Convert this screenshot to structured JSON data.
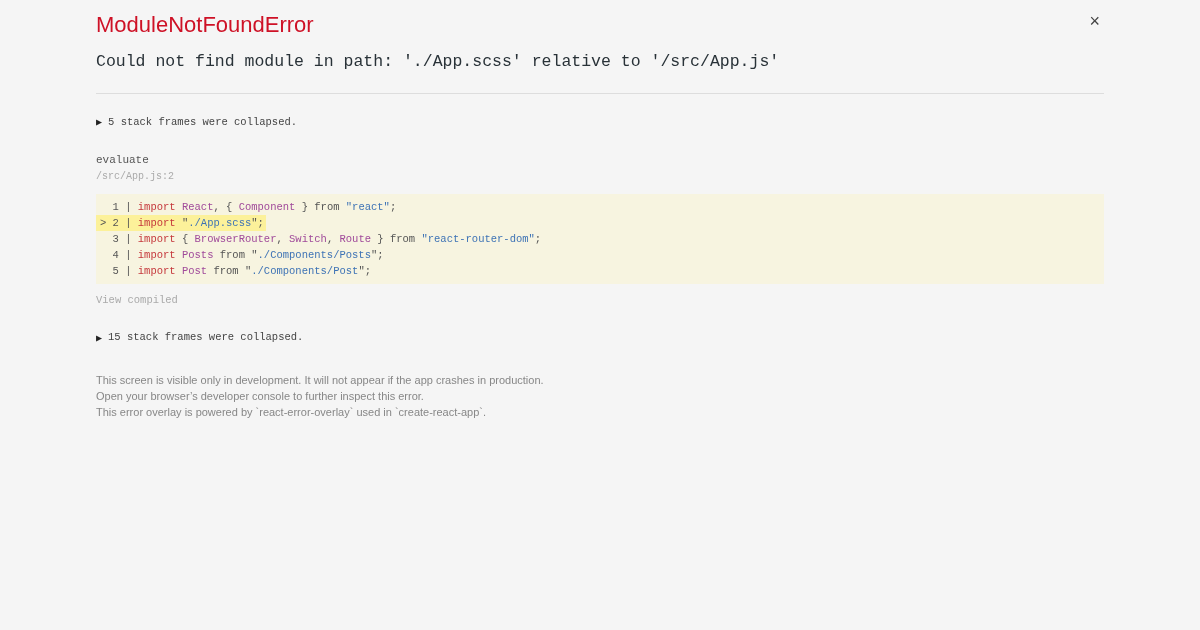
{
  "header": {
    "title": "ModuleNotFoundError",
    "close": "×",
    "message": "Could not find module in path: './App.scss' relative to '/src/App.js'"
  },
  "frames_top": {
    "toggle": "▶",
    "text": "5 stack frames were collapsed."
  },
  "frame": {
    "function": "evaluate",
    "location": "/src/App.js:2",
    "code_lines": [
      {
        "gutter": "  1 | ",
        "selected": false,
        "tokens": [
          {
            "kind": "keyword",
            "text": "import "
          },
          {
            "kind": "ident",
            "text": "React"
          },
          {
            "kind": "plain",
            "text": ", { "
          },
          {
            "kind": "ident",
            "text": "Component"
          },
          {
            "kind": "plain",
            "text": " } from "
          },
          {
            "kind": "string",
            "text": "\"react\""
          },
          {
            "kind": "plain",
            "text": ";"
          }
        ]
      },
      {
        "gutter": "> 2 | ",
        "selected": true,
        "tokens": [
          {
            "kind": "keyword",
            "text": "import"
          },
          {
            "kind": "plain",
            "text": " \""
          },
          {
            "kind": "string",
            "text": "./App.scss"
          },
          {
            "kind": "plain",
            "text": "\";"
          }
        ]
      },
      {
        "gutter": "  3 | ",
        "selected": false,
        "tokens": [
          {
            "kind": "keyword",
            "text": "import"
          },
          {
            "kind": "plain",
            "text": " { "
          },
          {
            "kind": "ident",
            "text": "BrowserRouter"
          },
          {
            "kind": "plain",
            "text": ", "
          },
          {
            "kind": "ident",
            "text": "Switch"
          },
          {
            "kind": "plain",
            "text": ", "
          },
          {
            "kind": "ident",
            "text": "Route"
          },
          {
            "kind": "plain",
            "text": " } from "
          },
          {
            "kind": "string",
            "text": "\"react-router-dom\""
          },
          {
            "kind": "plain",
            "text": ";"
          }
        ]
      },
      {
        "gutter": "  4 | ",
        "selected": false,
        "tokens": [
          {
            "kind": "keyword",
            "text": "import "
          },
          {
            "kind": "ident",
            "text": "Posts"
          },
          {
            "kind": "plain",
            "text": " from \""
          },
          {
            "kind": "string",
            "text": "./Components/Posts"
          },
          {
            "kind": "plain",
            "text": "\";"
          }
        ]
      },
      {
        "gutter": "  5 | ",
        "selected": false,
        "tokens": [
          {
            "kind": "keyword",
            "text": "import "
          },
          {
            "kind": "ident",
            "text": "Post"
          },
          {
            "kind": "plain",
            "text": " from \""
          },
          {
            "kind": "string",
            "text": "./Components/Post"
          },
          {
            "kind": "plain",
            "text": "\";"
          }
        ]
      }
    ],
    "view_compiled": "View compiled"
  },
  "frames_bottom": {
    "toggle": "▶",
    "text": "15 stack frames were collapsed."
  },
  "footer": [
    "This screen is visible only in development. It will not appear if the app crashes in production.",
    "Open your browser’s developer console to further inspect this error.",
    "This error overlay is powered by `react-error-overlay` used in `create-react-app`."
  ]
}
